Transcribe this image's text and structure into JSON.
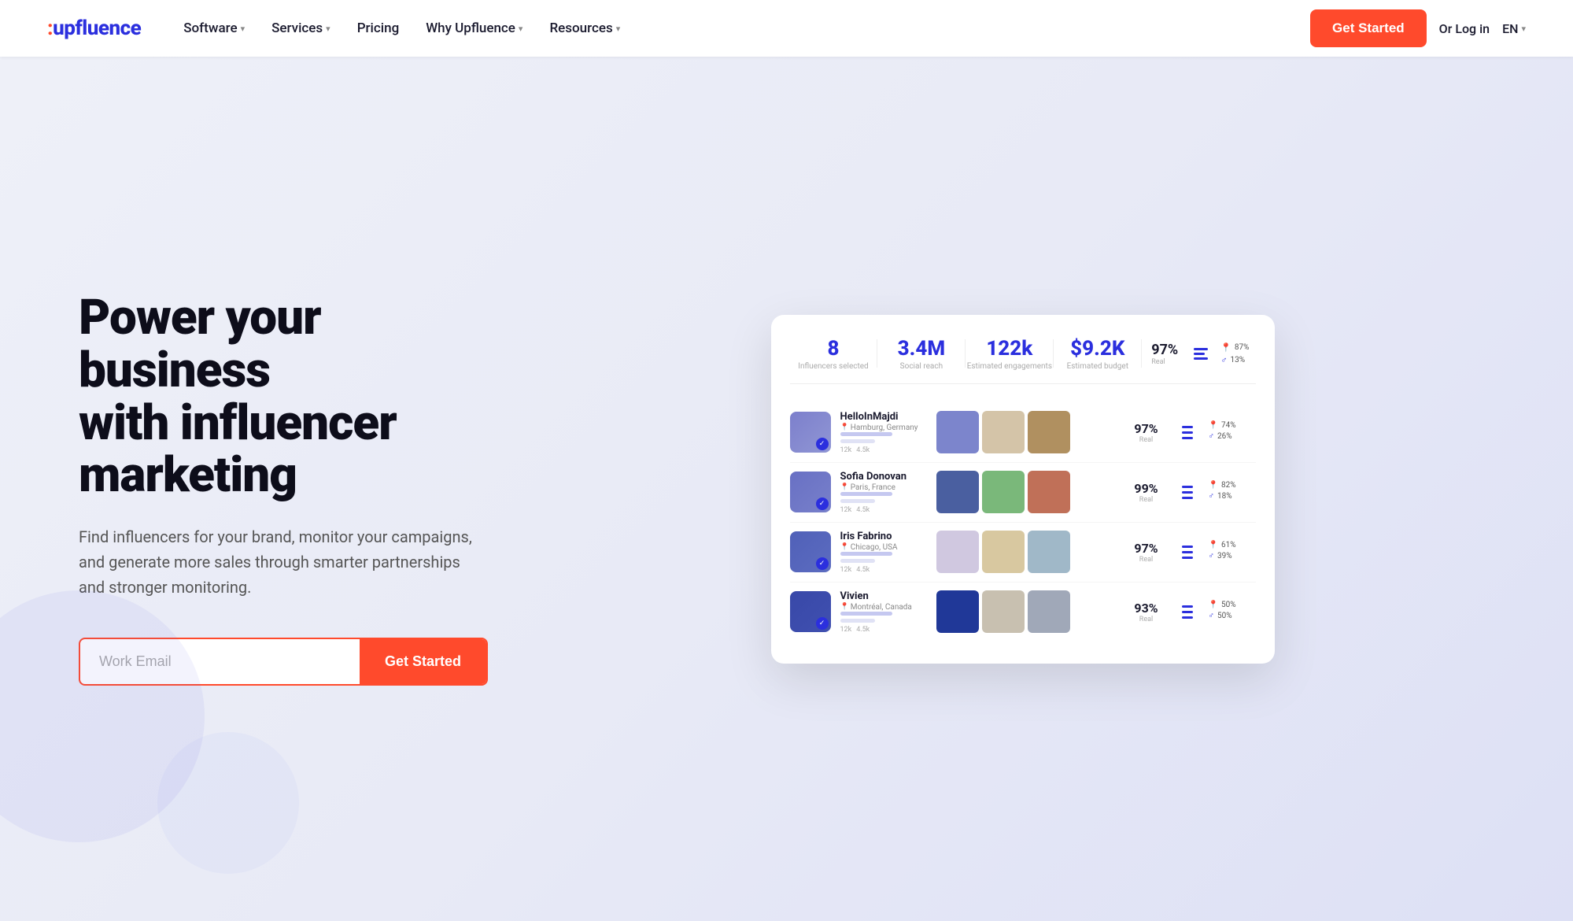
{
  "nav": {
    "logo": "upfluence",
    "logo_accent": "·",
    "items": [
      {
        "label": "Software",
        "has_dropdown": true
      },
      {
        "label": "Services",
        "has_dropdown": true
      },
      {
        "label": "Pricing",
        "has_dropdown": false
      },
      {
        "label": "Why Upfluence",
        "has_dropdown": true
      },
      {
        "label": "Resources",
        "has_dropdown": true
      }
    ],
    "cta_label": "Get Started",
    "login_label": "Or Log in",
    "lang_label": "EN"
  },
  "hero": {
    "headline_line1": "Power your business",
    "headline_line2": "with influencer",
    "headline_line3": "marketing",
    "subtext": "Find influencers for your brand, monitor your campaigns, and generate more sales through smarter partnerships and stronger monitoring.",
    "input_placeholder": "Work Email",
    "cta_label": "Get Started"
  },
  "dashboard": {
    "stats": [
      {
        "value": "8",
        "label": "Influencers selected"
      },
      {
        "value": "3.4M",
        "label": "Social reach"
      },
      {
        "value": "122k",
        "label": "Estimated engagements"
      },
      {
        "value": "$9.2K",
        "label": "Estimated budget"
      }
    ],
    "stat_extras": {
      "real_pct": "97%",
      "real_label": "Real",
      "female_pct": "87%",
      "male_pct": "13%"
    },
    "influencers": [
      {
        "name": "HelloInMajdi",
        "location": "Hamburg, Germany",
        "score": "97%",
        "score_label": "Real",
        "female_pct": "74%",
        "male_pct": "26%",
        "colors": [
          "#7c7fcc",
          "#b8b4e8",
          "#9096d4"
        ],
        "photo_colors": [
          "#5a6ab0",
          "#e8d5c0",
          "#c9a87c"
        ]
      },
      {
        "name": "Sofia Donovan",
        "location": "Paris, France",
        "score": "99%",
        "score_label": "Real",
        "female_pct": "82%",
        "male_pct": "18%",
        "colors": [
          "#6870c4",
          "#8890d0",
          "#7880ca"
        ],
        "photo_colors": [
          "#4a5fa0",
          "#8fbe8f",
          "#c87060"
        ]
      },
      {
        "name": "Iris Fabrino",
        "location": "Chicago, USA",
        "score": "97%",
        "score_label": "Real",
        "female_pct": "61%",
        "male_pct": "39%",
        "colors": [
          "#5060b8",
          "#6878c8",
          "#5c6cc0"
        ],
        "photo_colors": [
          "#d8d0e8",
          "#e0c8a8",
          "#b8c8e0"
        ]
      },
      {
        "name": "Vivien",
        "location": "Montréal, Canada",
        "score": "93%",
        "score_label": "Real",
        "female_pct": "50%",
        "male_pct": "50%",
        "colors": [
          "#3848a8",
          "#4858b8",
          "#4050b0"
        ],
        "photo_colors": [
          "#2040a0",
          "#d0c8b8",
          "#b0b8c8"
        ]
      }
    ]
  }
}
